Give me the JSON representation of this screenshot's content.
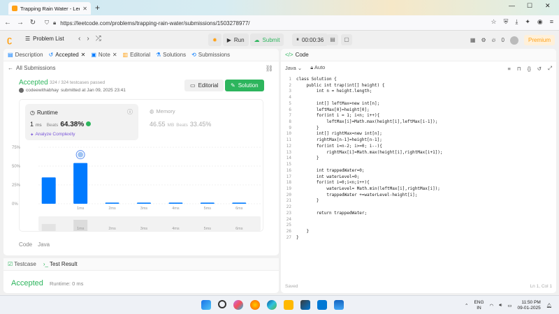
{
  "browser": {
    "tab_title": "Trapping Rain Water - LeetCode",
    "url": "https://leetcode.com/problems/trapping-rain-water/submissions/1503278977/",
    "new_tab": "+",
    "close_tab": "✕"
  },
  "header": {
    "problem_list": "Problem List",
    "run": "Run",
    "submit": "Submit",
    "timer": "00:00:36",
    "fire_count": "0",
    "premium": "Premium"
  },
  "left_tabs": [
    {
      "label": "Description",
      "icon": "description-icon"
    },
    {
      "label": "Accepted",
      "icon": "history-icon"
    },
    {
      "label": "Note",
      "icon": "note-icon"
    },
    {
      "label": "Editorial",
      "icon": "editorial-icon"
    },
    {
      "label": "Solutions",
      "icon": "flask-icon"
    },
    {
      "label": "Submissions",
      "icon": "submissions-icon"
    }
  ],
  "submission": {
    "back": "All Submissions",
    "status": "Accepted",
    "passed": "324 / 324 testcases passed",
    "author": "codeewithabhay",
    "submitted_at": "submitted at Jan 09, 2025 23:41",
    "editorial_btn": "Editorial",
    "solution_btn": "Solution",
    "runtime_title": "Runtime",
    "runtime_value": "1",
    "runtime_unit": "ms",
    "runtime_beats_label": "Beats",
    "runtime_beats": "64.38%",
    "analyze": "Analyze Complexity",
    "memory_title": "Memory",
    "memory_value": "46.55",
    "memory_unit": "MB",
    "memory_beats_label": "Beats",
    "memory_beats": "33.45%",
    "lang_code": "Code",
    "lang_java": "Java"
  },
  "chart_data": {
    "type": "bar",
    "yticks": [
      "75%",
      "50%",
      "25%",
      "0%"
    ],
    "ylim": [
      0,
      75
    ],
    "categories": [
      "",
      "1ms",
      "2ms",
      "3ms",
      "4ms",
      "5ms",
      "6ms"
    ],
    "values": [
      35,
      54,
      1.5,
      1.5,
      1.5,
      1.5,
      1.5
    ],
    "highlight_index": 1,
    "colors": {
      "bar": "#007aff",
      "grid": "#e5e5e5"
    }
  },
  "test_panel": {
    "testcase": "Testcase",
    "result": "Test Result",
    "status": "Accepted",
    "runtime": "Runtime: 0 ms"
  },
  "code_panel": {
    "title": "Code",
    "language": "Java",
    "mode": "Auto",
    "saved": "Saved",
    "cursor": "Ln 1, Col 1",
    "lines": [
      "class Solution {",
      "    public int trap(int[] height) {",
      "        int n = height.length;",
      "",
      "        int[] leftMax=new int[n];",
      "        leftMax[0]=height[0];",
      "        for(int i = 1; i<n; i++){",
      "            leftMax[i]=Math.max(height[i],leftMax[i-1]);",
      "        }",
      "        int[] rightMax=new int[n];",
      "        rightMax[n-1]=height[n-1];",
      "        for(int i=n-2; i>=0; i--){",
      "            rightMax[i]=Math.max(height[i],rightMax[i+1]);",
      "        }",
      "",
      "        int trappedWater=0;",
      "        int waterLevel=0;",
      "        for(int i=0;i<n;i++){",
      "            waterLevel= Math.min(leftMax[i],rightMax[i]);",
      "            trappedWater +=waterLevel-height[i];",
      "        }",
      "",
      "        return trappedWater;",
      "",
      "",
      "    }",
      "}"
    ]
  },
  "taskbar": {
    "lang_top": "ENG",
    "lang_bottom": "IN",
    "time": "11:50 PM",
    "date": "09-01-2025"
  }
}
